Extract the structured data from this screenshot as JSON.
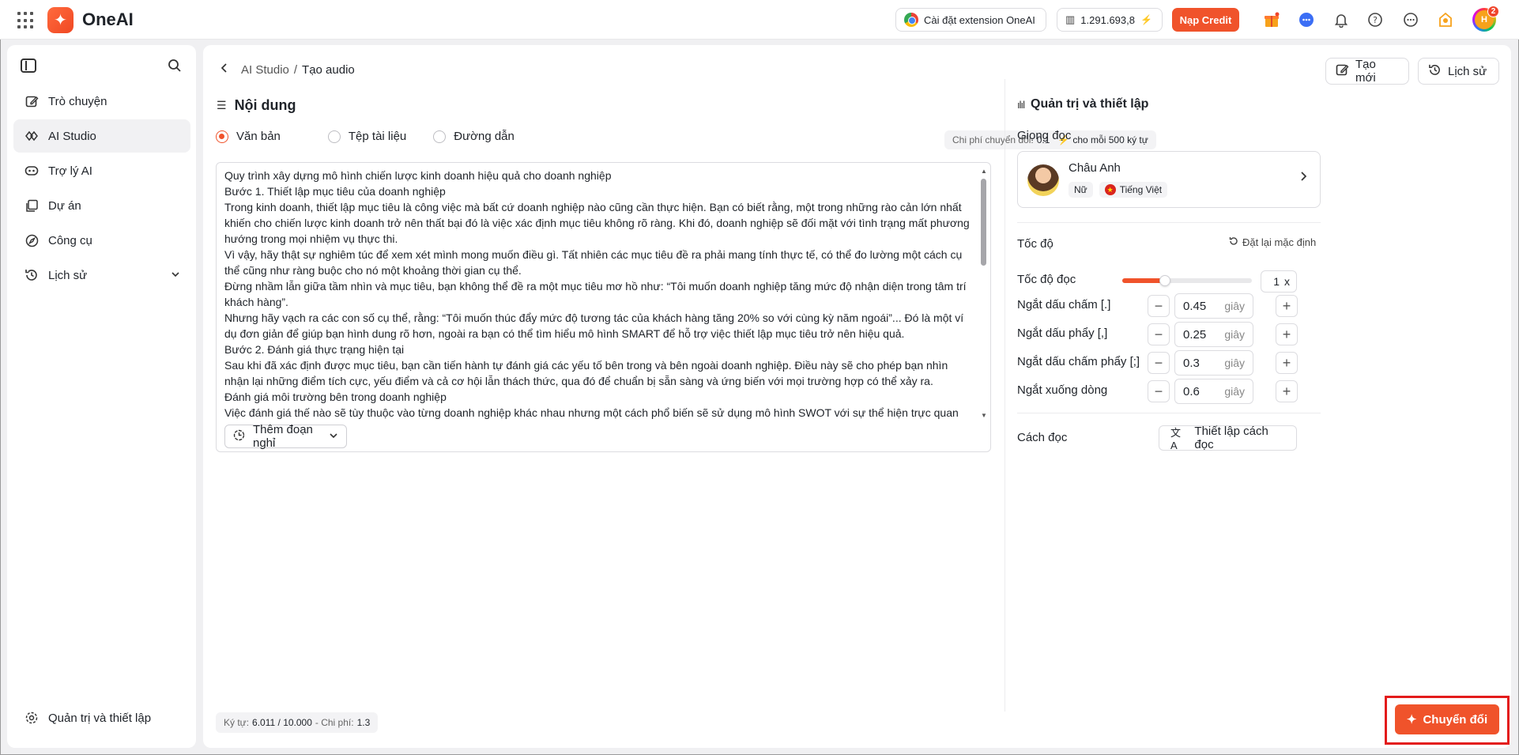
{
  "app": {
    "brand": "OneAI"
  },
  "topbar": {
    "extension_label": "Cài đặt extension OneAI",
    "credits": "1.291.693,8",
    "topup_label": "Nạp Credit",
    "avatar_initials": "H",
    "notification_count": "2",
    "icons": [
      "apps-grid-icon",
      "gift-icon",
      "chat-icon",
      "bell-icon",
      "help-icon",
      "more-icon",
      "badge-icon"
    ]
  },
  "sidebar": {
    "items": [
      {
        "label": "Trò chuyện",
        "icon": "edit-icon"
      },
      {
        "label": "AI Studio",
        "icon": "studio-icon"
      },
      {
        "label": "Trợ lý AI",
        "icon": "bot-icon"
      },
      {
        "label": "Dự án",
        "icon": "folder-icon"
      },
      {
        "label": "Công cụ",
        "icon": "compass-icon"
      },
      {
        "label": "Lịch sử",
        "icon": "history-icon"
      }
    ],
    "settings_label": "Quản trị và thiết lập"
  },
  "header": {
    "breadcrumb_parent": "AI Studio",
    "breadcrumb_sep": "/",
    "breadcrumb_current": "Tạo audio",
    "new_label": "Tạo mới",
    "history_label": "Lịch sử"
  },
  "content": {
    "title": "Nội dung",
    "source_options": [
      "Văn bản",
      "Tệp tài liệu",
      "Đường dẫn"
    ],
    "selected_source": "Văn bản",
    "cost_label": "Chi phí chuyển đổi:",
    "cost_value": "0.1",
    "cost_unit": "cho mỗi 500 ký tự",
    "text": "Quy trình xây dựng mô hình chiến lược kinh doanh hiệu quả cho doanh nghiệp\nBước 1. Thiết lập mục tiêu của doanh nghiệp\nTrong kinh doanh, thiết lập mục tiêu là công việc mà bất cứ doanh nghiệp nào cũng cần thực hiện. Bạn có biết rằng, một trong những rào cản lớn nhất khiến cho chiến lược kinh doanh trở nên thất bại đó là việc xác định mục tiêu không rõ ràng. Khi đó, doanh nghiệp sẽ đối mặt với tình trạng mất phương hướng trong mọi nhiệm vụ thực thi.\nVì vậy, hãy thật sự nghiêm túc để xem xét mình mong muốn điều gì. Tất nhiên các mục tiêu đề ra phải mang tính thực tế, có thể đo lường một cách cụ thể cũng như ràng buộc cho nó một khoảng thời gian cụ thể.\nĐừng nhầm lẫn giữa tầm nhìn và mục tiêu, bạn không thể đề ra một mục tiêu mơ hồ như: “Tôi muốn doanh nghiệp tăng mức độ nhận diện trong tâm trí khách hàng”.\nNhưng hãy vạch ra các con số cụ thể, rằng: “Tôi muốn thúc đẩy mức độ tương tác của khách hàng tăng 20% so với cùng kỳ năm ngoái”... Đó là một ví dụ đơn giản để giúp bạn hình dung rõ hơn, ngoài ra bạn có thể tìm hiểu mô hình SMART để hỗ trợ việc thiết lập mục tiêu trở nên hiệu quả.\nBước 2. Đánh giá thực trạng hiện tại\nSau khi đã xác định được mục tiêu, bạn cần tiến hành tự đánh giá các yếu tố bên trong và bên ngoài doanh nghiệp. Điều này sẽ cho phép bạn nhìn nhận lại những điểm tích cực, yếu điểm và cả cơ hội lẫn thách thức, qua đó để chuẩn bị sẵn sàng và ứng biến với mọi trường hợp có thể xảy ra.\nĐánh giá môi trường bên trong doanh nghiệp\nViệc đánh giá thế nào sẽ tùy thuộc vào từng doanh nghiệp khác nhau nhưng một cách phổ biến sẽ sử dụng mô hình SWOT với sự thể hiện trực quan mà nó mang lại. Với SWOT, bạn sẽ dễ dàng xác định những lợi thế nào mà sản phẩm mình đang nắm giữ qua đó để duy trì và phát triển nó tốt hơn. Ngược lại, điểm yếu cũng sẽ được phát hiện và thể hiện một cách rõ ràng.\nThông thường, nó sẽ giúp doanh nghiệp phân tích về các lĩnh vực: hoạt động quản lý, sản xuất, kinh doanh, marketing, nhân sự, R&D... từ đó đưa ra phương hướng đúng đắn nhất cho hoạt động xây dựng chiến lược kinh doanh được tối ưu nhất.\nPhân tích môi trường bên ngoài\nTrên thực tế khi đánh giá nội bộ doanh nghiệp, SWOT đã giúp bạn phần nào xác định những cơ hội và thách thức có thể tác động từ môi trường",
    "pause_label": "Thêm đoạn nghỉ",
    "char_label": "Ký tự:",
    "char_count": "6.011 / 10.000",
    "cost_footer_label": "- Chi phí:",
    "cost_footer_value": "1.3"
  },
  "settings": {
    "title": "Quản trị và thiết lập",
    "voice_label": "Giọng đọc",
    "voice": {
      "name": "Châu Anh",
      "gender": "Nữ",
      "language": "Tiếng Việt"
    },
    "speed_section": "Tốc độ",
    "reset_label": "Đặt lại mặc định",
    "speed_label": "Tốc độ đọc",
    "speed_value": "1",
    "speed_unit": "x",
    "speed_fraction": 0.33,
    "pauses": [
      {
        "label": "Ngắt dấu chấm [.]",
        "value": "0.45",
        "unit": "giây"
      },
      {
        "label": "Ngắt dấu phẩy [,]",
        "value": "0.25",
        "unit": "giây"
      },
      {
        "label": "Ngắt dấu chấm phẩy [;]",
        "value": "0.3",
        "unit": "giây"
      },
      {
        "label": "Ngắt xuống dòng",
        "value": "0.6",
        "unit": "giây"
      }
    ],
    "reading_label": "Cách đọc",
    "reading_button": "Thiết lập cách đọc",
    "convert_label": "Chuyển đổi"
  },
  "colors": {
    "accent": "#f0532b",
    "highlight": "#e31b1b"
  }
}
